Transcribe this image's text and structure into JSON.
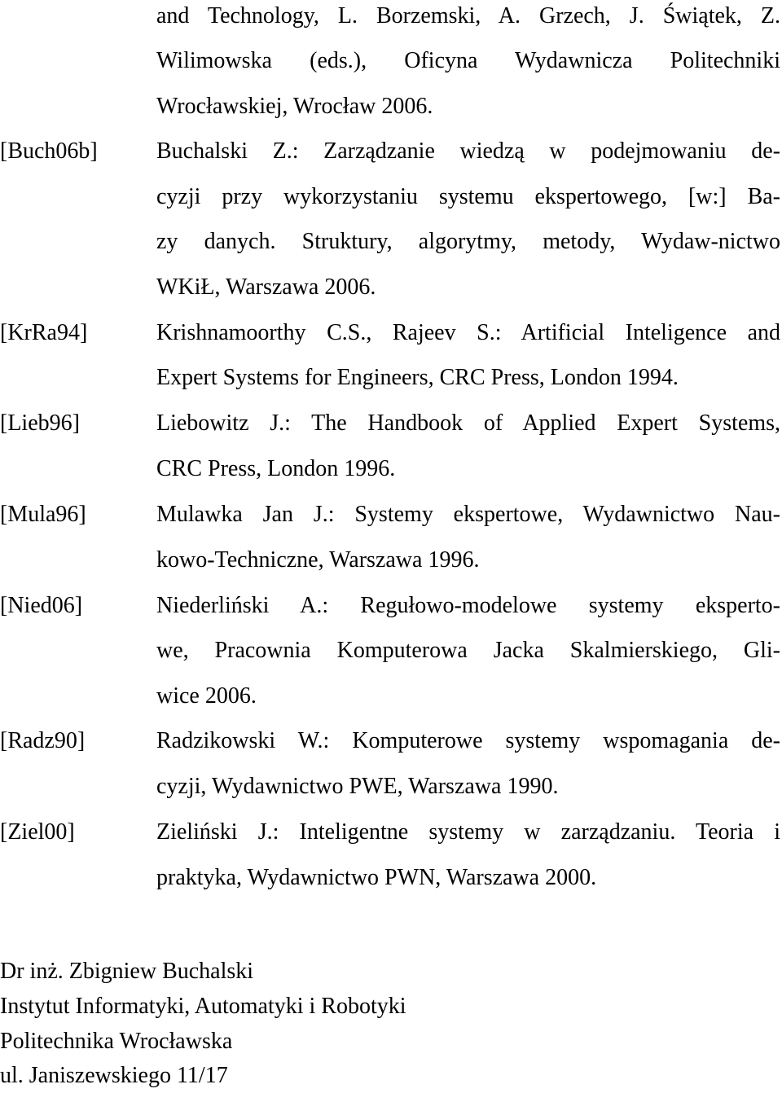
{
  "continuation": {
    "lines": [
      "and Technology, L. Borzemski, A. Grzech, J. Świątek, Z.",
      "Wilimowska (eds.), Oficyna Wydawnicza Politechniki",
      "Wrocławskiej, Wrocław 2006."
    ]
  },
  "references": [
    {
      "key": "[Buch06b]",
      "lines": [
        "Buchalski Z.: Zarządzanie wiedzą w podejmowaniu de-",
        "cyzji przy wykorzystaniu systemu ekspertowego, [w:] Ba-",
        "zy danych. Struktury, algorytmy, metody, Wydaw-nictwo",
        "WKiŁ, Warszawa 2006."
      ]
    },
    {
      "key": "[KrRa94]",
      "lines": [
        "Krishnamoorthy C.S., Rajeev S.: Artificial Inteligence and",
        "Expert Systems for Engineers, CRC Press, London 1994."
      ]
    },
    {
      "key": "[Lieb96]",
      "lines": [
        "Liebowitz J.: The Handbook of Applied Expert Systems,",
        "CRC Press, London 1996."
      ]
    },
    {
      "key": "[Mula96]",
      "lines": [
        "Mulawka Jan J.: Systemy ekspertowe, Wydawnictwo Nau-",
        "kowo-Techniczne, Warszawa 1996."
      ]
    },
    {
      "key": "[Nied06]",
      "lines": [
        "Niederliński A.: Regułowo-modelowe systemy eksperto-",
        "we, Pracownia Komputerowa Jacka Skalmierskiego, Gli-",
        "wice 2006."
      ]
    },
    {
      "key": "[Radz90]",
      "lines": [
        "Radzikowski W.: Komputerowe systemy wspomagania de-",
        "cyzji, Wydawnictwo PWE, Warszawa 1990."
      ]
    },
    {
      "key": "[Ziel00]",
      "lines": [
        "Zieliński J.: Inteligentne systemy w zarządzaniu. Teoria i",
        "praktyka, Wydawnictwo PWN, Warszawa 2000."
      ]
    }
  ],
  "author": {
    "name": "Dr inż. Zbigniew Buchalski",
    "institute": "Instytut Informatyki, Automatyki i Robotyki",
    "university": "Politechnika Wrocławska",
    "address": "ul. Janiszewskiego 11/17"
  }
}
